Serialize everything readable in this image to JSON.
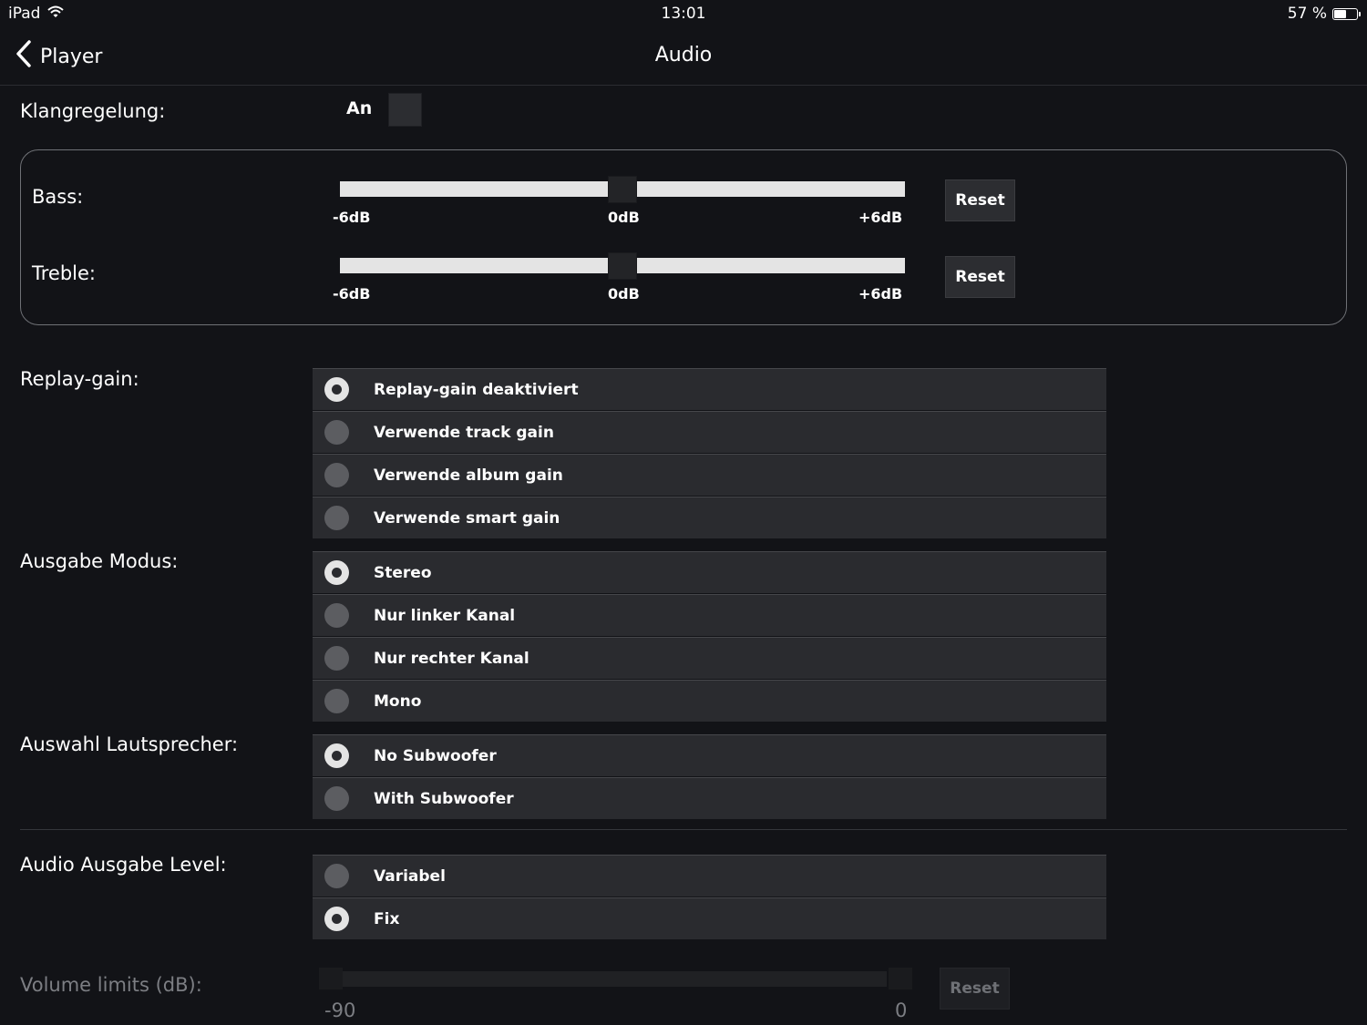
{
  "status_bar": {
    "device": "iPad",
    "time": "13:01",
    "battery_text": "57 %",
    "battery_level": 0.57
  },
  "nav": {
    "back_label": "Player",
    "title": "Audio"
  },
  "klang": {
    "label": "Klangregelung:",
    "toggle_label": "An",
    "enabled": false
  },
  "eq": {
    "bass": {
      "label": "Bass:",
      "min_label": "-6dB",
      "mid_label": "0dB",
      "max_label": "+6dB",
      "value_db": 0,
      "reset_label": "Reset"
    },
    "treble": {
      "label": "Treble:",
      "min_label": "-6dB",
      "mid_label": "0dB",
      "max_label": "+6dB",
      "value_db": 0,
      "reset_label": "Reset"
    }
  },
  "replay_gain": {
    "label": "Replay-gain:",
    "options": [
      {
        "label": "Replay-gain deaktiviert",
        "checked": true
      },
      {
        "label": "Verwende track gain",
        "checked": false
      },
      {
        "label": "Verwende album gain",
        "checked": false
      },
      {
        "label": "Verwende smart gain",
        "checked": false
      }
    ]
  },
  "output_mode": {
    "label": "Ausgabe Modus:",
    "options": [
      {
        "label": "Stereo",
        "checked": true
      },
      {
        "label": "Nur linker Kanal",
        "checked": false
      },
      {
        "label": "Nur rechter Kanal",
        "checked": false
      },
      {
        "label": "Mono",
        "checked": false
      }
    ]
  },
  "speakers": {
    "label": "Auswahl Lautsprecher:",
    "options": [
      {
        "label": "No Subwoofer",
        "checked": true
      },
      {
        "label": "With Subwoofer",
        "checked": false
      }
    ]
  },
  "output_level": {
    "label": "Audio Ausgabe Level:",
    "options": [
      {
        "label": "Variabel",
        "checked": false
      },
      {
        "label": "Fix",
        "checked": true
      }
    ]
  },
  "volume_limits": {
    "label": "Volume limits (dB):",
    "min_label": "-90",
    "max_label": "0",
    "reset_label": "Reset"
  }
}
